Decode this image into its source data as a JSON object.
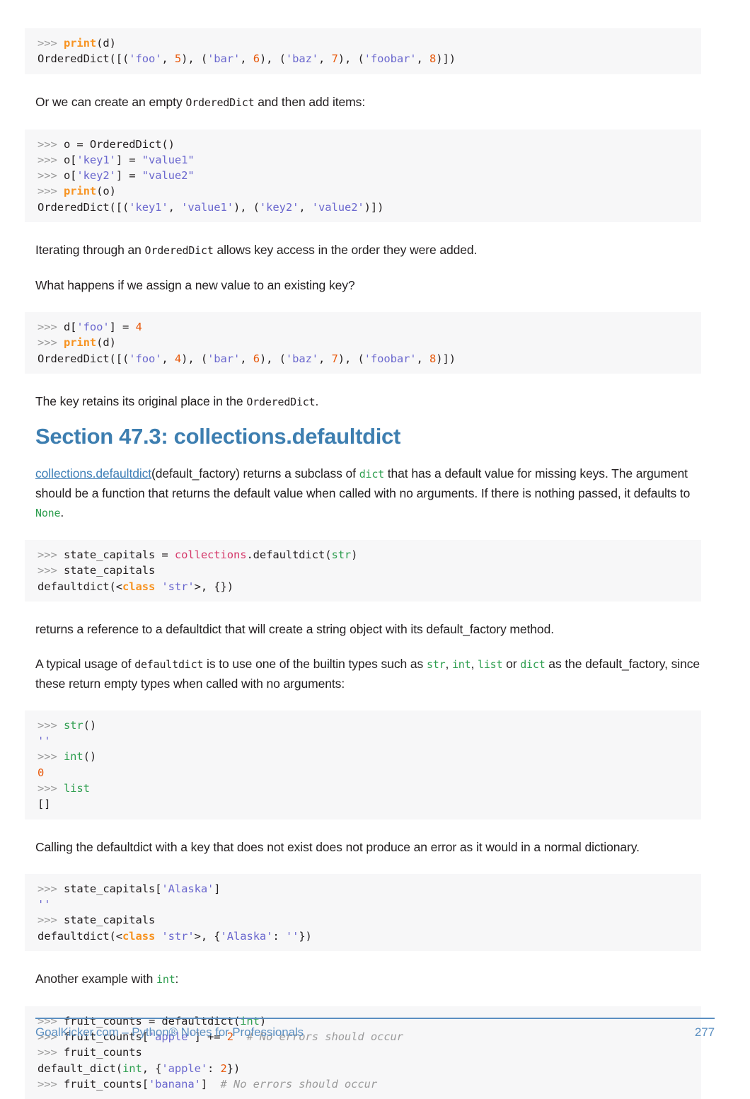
{
  "document": {
    "page_number": "277",
    "footer_text": "GoalKicker.com – Python® Notes for Professionals",
    "accent_color": "#5b8fc1",
    "heading_color": "#3d7eb0",
    "code_bg_color": "#f7f7f8"
  },
  "blocks": {
    "code1_line1": ">>> print(d)",
    "code1_line2": "OrderedDict([('foo', 5), ('bar', 6), ('baz', 7), ('foobar', 8)])",
    "para1_a": "Or we can create an empty ",
    "para1_code": "OrderedDict",
    "para1_b": " and then add items:",
    "code2_line1": ">>> o = OrderedDict()",
    "code2_line2": ">>> o['key1'] = \"value1\"",
    "code2_line3": ">>> o['key2'] = \"value2\"",
    "code2_line4": ">>> print(o)",
    "code2_line5": "OrderedDict([('key1', 'value1'), ('key2', 'value2')])",
    "para2_a": "Iterating through an ",
    "para2_code": "OrderedDict",
    "para2_b": " allows key access in the order they were added.",
    "para3": "What happens if we assign a new value to an existing key?",
    "code3_line1": ">>> d['foo'] = 4",
    "code3_line2": ">>> print(d)",
    "code3_line3": "OrderedDict([('foo', 4), ('bar', 6), ('baz', 7), ('foobar', 8)])",
    "para4_a": "The key retains its original place in the ",
    "para4_code": "OrderedDict",
    "para4_b": ".",
    "heading": "Section 47.3: collections.defaultdict",
    "para5_link": "collections.defaultdict",
    "para5_a": "(default_factory) returns a subclass of ",
    "para5_code1": "dict",
    "para5_b": " that has a default value for missing keys. The argument should be a function that returns the default value when called with no arguments. If there is nothing passed, it defaults to ",
    "para5_code2": "None",
    "para5_c": ".",
    "code4_line1": ">>> state_capitals = collections.defaultdict(str)",
    "code4_line2": ">>> state_capitals",
    "code4_line3": "defaultdict(<class 'str'>, {})",
    "para6": "returns a reference to a defaultdict that will create a string object with its default_factory method.",
    "para7_a": "A typical usage of ",
    "para7_code1": "defaultdict",
    "para7_b": " is to use one of the builtin types such as ",
    "para7_code2": "str",
    "para7_c": ", ",
    "para7_code3": "int",
    "para7_d": ", ",
    "para7_code4": "list",
    "para7_e": " or ",
    "para7_code5": "dict",
    "para7_f": " as the default_factory, since these return empty types when called with no arguments:",
    "code5_line1": ">>> str()",
    "code5_line2": "''",
    "code5_line3": ">>> int()",
    "code5_line4": "0",
    "code5_line5": ">>> list",
    "code5_line6": "[]",
    "para8": "Calling the defaultdict with a key that does not exist does not produce an error as it would in a normal dictionary.",
    "code6_line1": ">>> state_capitals['Alaska']",
    "code6_line2": "''",
    "code6_line3": ">>> state_capitals",
    "code6_line4": "defaultdict(<class 'str'>, {'Alaska': ''})",
    "para9_a": "Another example with ",
    "para9_code": "int",
    "para9_b": ":",
    "code7_line1": ">>> fruit_counts = defaultdict(int)",
    "code7_line2": ">>> fruit_counts['apple'] += 2  # No errors should occur",
    "code7_line3": ">>> fruit_counts",
    "code7_line4": "default_dict(int, {'apple': 2})",
    "code7_line5": ">>> fruit_counts['banana']  # No errors should occur"
  }
}
